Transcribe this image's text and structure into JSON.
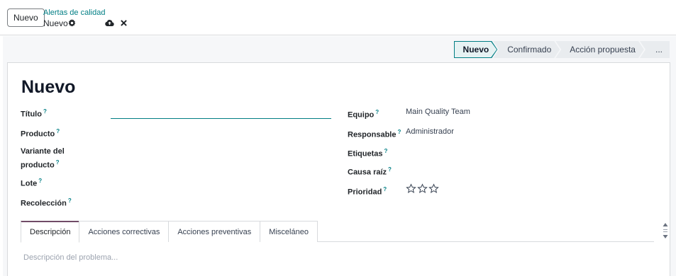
{
  "header": {
    "new_button": "Nuevo",
    "breadcrumb": "Alertas de calidad",
    "record_name": "Nuevo",
    "icons": [
      "gear-icon",
      "cloud-upload-icon",
      "close-icon"
    ]
  },
  "statusbar": {
    "stages": [
      "Nuevo",
      "Confirmado",
      "Acción propuesta",
      "..."
    ],
    "active": "Nuevo"
  },
  "form": {
    "title": "Nuevo",
    "help_mark": "?",
    "left_fields": {
      "titulo": "Título",
      "producto": "Producto",
      "variante_1": "Variante del",
      "variante_2": "producto",
      "lote": "Lote",
      "recoleccion": "Recolección"
    },
    "right_fields": {
      "equipo": {
        "label": "Equipo",
        "value": "Main Quality Team"
      },
      "responsable": {
        "label": "Responsable",
        "value": "Administrador"
      },
      "etiquetas": {
        "label": "Etiquetas"
      },
      "causa_raiz": {
        "label": "Causa raíz"
      },
      "prioridad": {
        "label": "Prioridad",
        "stars_filled": 0,
        "stars_total": 3
      }
    }
  },
  "tabs": [
    "Descripción",
    "Acciones correctivas",
    "Acciones preventivas",
    "Misceláneo"
  ],
  "active_tab": "Descripción",
  "description_placeholder": "Descripción del problema...",
  "colors": {
    "accent": "#017e84",
    "brand": "#714b67"
  }
}
